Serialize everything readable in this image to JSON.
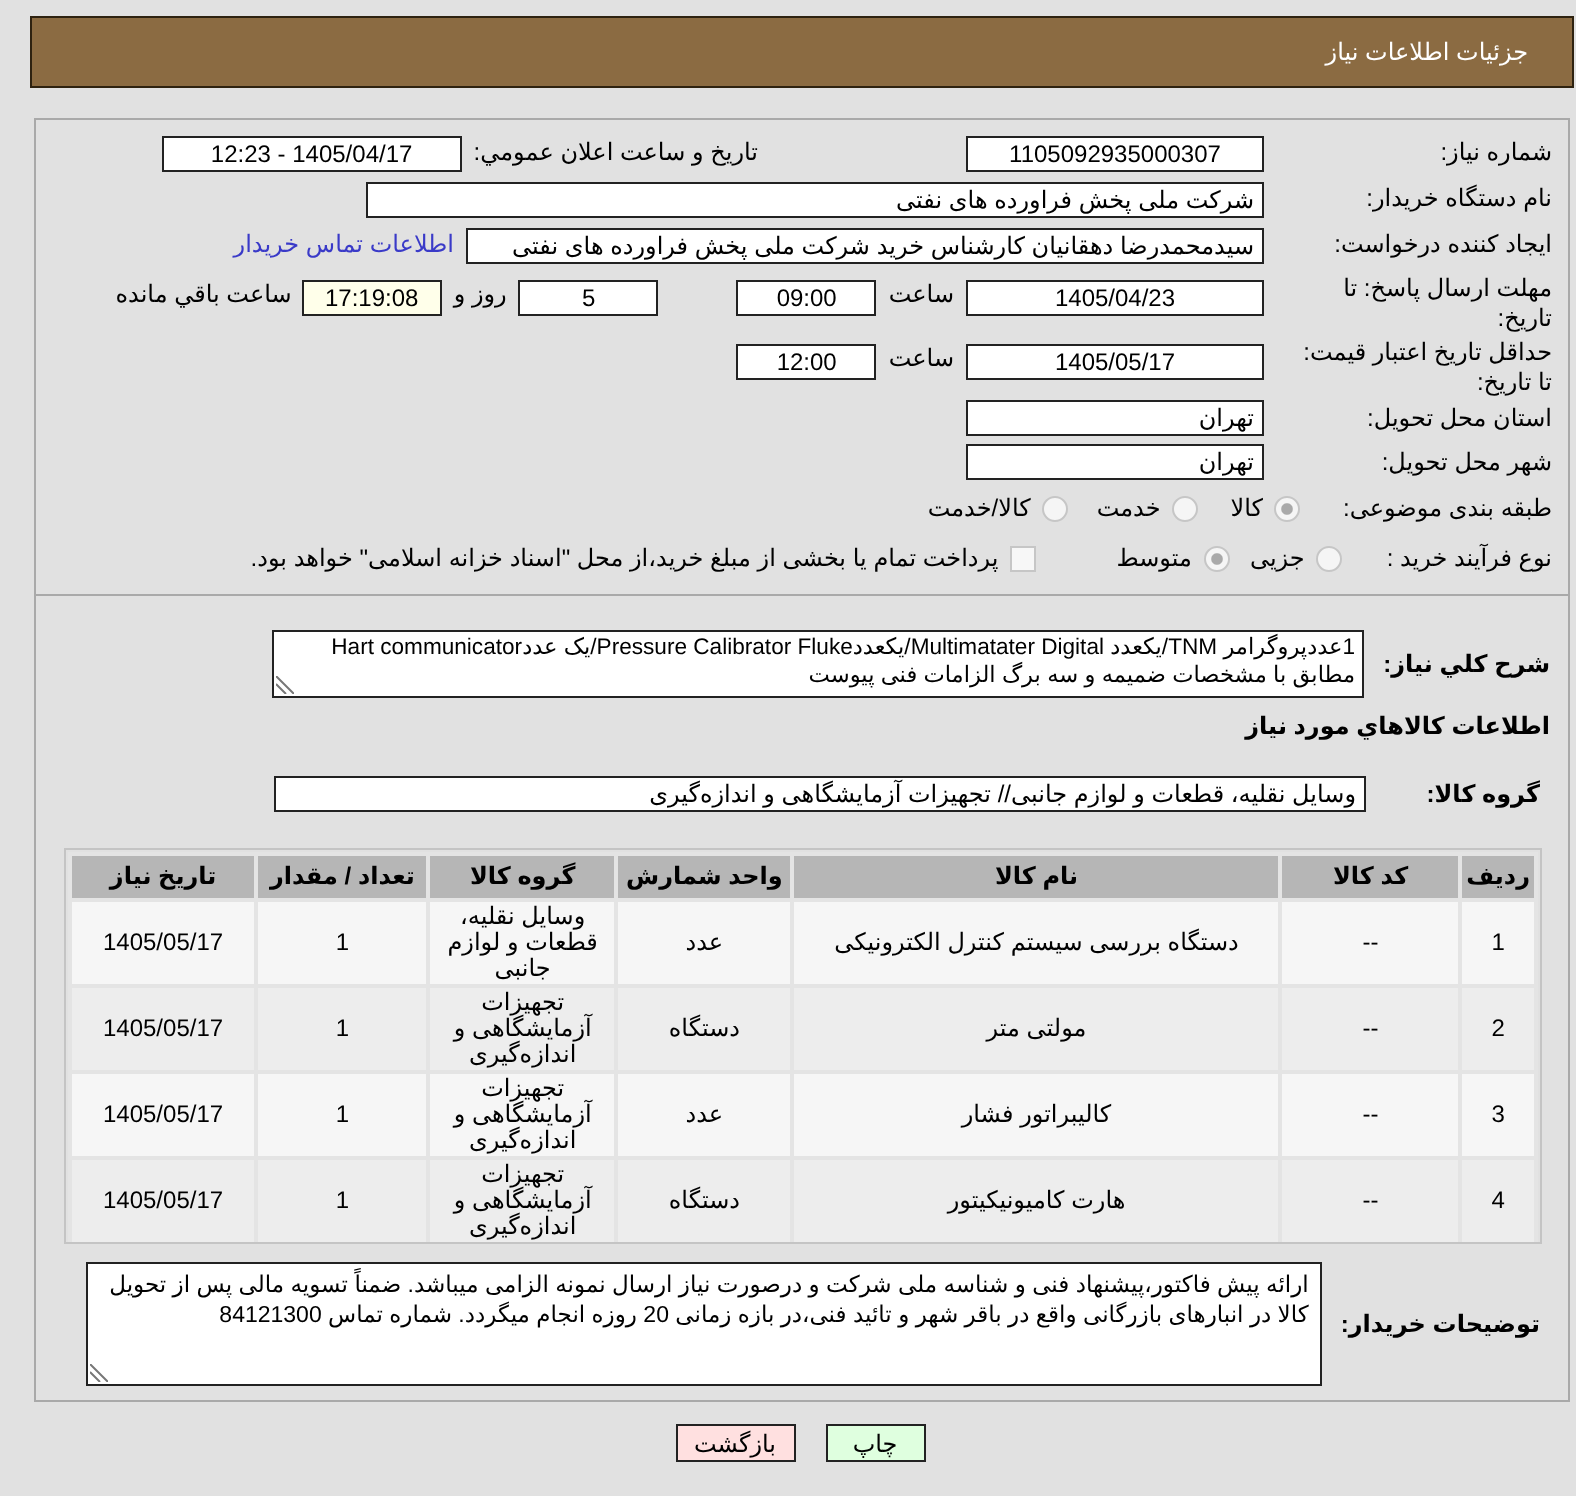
{
  "header": {
    "title": "جزئیات اطلاعات نیاز"
  },
  "need_number": {
    "label": "شماره نیاز:",
    "value": "1105092935000307"
  },
  "announcement": {
    "label": "تاریخ و ساعت اعلان عمومي:",
    "value": "1405/04/17 - 12:23"
  },
  "buyer_org": {
    "label": "نام دستگاه خریدار:",
    "value": "شرکت ملی پخش فراورده های نفتی"
  },
  "requester": {
    "label": "ایجاد کننده درخواست:",
    "value": "سیدمحمدرضا دهقانیان کارشناس خرید شرکت ملی پخش فراورده های نفتی",
    "contact_link": "اطلاعات تماس خریدار"
  },
  "response_deadline": {
    "label": "مهلت ارسال پاسخ: تا تاریخ:",
    "date": "1405/04/23",
    "time_label": "ساعت",
    "time": "09:00",
    "days": "5",
    "days_label": "روز و",
    "remaining": "17:19:08",
    "remaining_label": "ساعت باقي مانده"
  },
  "price_validity": {
    "label": "حداقل تاریخ اعتبار قیمت: تا تاریخ:",
    "date": "1405/05/17",
    "time_label": "ساعت",
    "time": "12:00"
  },
  "delivery_province": {
    "label": "استان محل تحویل:",
    "value": "تهران"
  },
  "delivery_city": {
    "label": "شهر محل تحویل:",
    "value": "تهران"
  },
  "category": {
    "label": "طبقه بندی موضوعی:",
    "options": [
      {
        "label": "کالا",
        "selected": true
      },
      {
        "label": "خدمت",
        "selected": false
      },
      {
        "label": "کالا/خدمت",
        "selected": false
      }
    ]
  },
  "purchase_type": {
    "label": "نوع فرآیند خرید :",
    "options": [
      {
        "label": "جزیی",
        "selected": false
      },
      {
        "label": "متوسط",
        "selected": true
      }
    ],
    "treasury_payment": {
      "label": "پرداخت تمام یا بخشی از مبلغ خرید،از محل \"اسناد خزانه اسلامی\" خواهد بود.",
      "checked": false
    }
  },
  "description": {
    "label": "شرح کلي نیاز:",
    "value": "1عددپروگرامر TNM/یکعدد Multimatater Digital/یکعددPressure Calibrator Fluke/یک عددHart communicator مطابق با مشخصات ضمیمه و سه برگ الزامات فنی پیوست"
  },
  "goods_heading": "اطلاعات کالاهاي مورد نیاز",
  "goods_group": {
    "label": "گروه کالا:",
    "value": "وسایل نقلیه، قطعات و لوازم جانبی// تجهیزات آزمایشگاهی و اندازه‌گیری"
  },
  "table": {
    "columns": [
      "ردیف",
      "کد کالا",
      "نام کالا",
      "واحد شمارش",
      "گروه کالا",
      "تعداد / مقدار",
      "تاریخ نیاز"
    ],
    "rows": [
      [
        "1",
        "--",
        "دستگاه بررسی سیستم کنترل الکترونیکی",
        "عدد",
        "وسایل نقلیه، قطعات و لوازم جانبی",
        "1",
        "1405/05/17"
      ],
      [
        "2",
        "--",
        "مولتی متر",
        "دستگاه",
        "تجهیزات آزمایشگاهی و اندازه‌گیری",
        "1",
        "1405/05/17"
      ],
      [
        "3",
        "--",
        "کالیبراتور فشار",
        "عدد",
        "تجهیزات آزمایشگاهی و اندازه‌گیری",
        "1",
        "1405/05/17"
      ],
      [
        "4",
        "--",
        "هارت کامیونیکیتور",
        "دستگاه",
        "تجهیزات آزمایشگاهی و اندازه‌گیری",
        "1",
        "1405/05/17"
      ]
    ]
  },
  "buyer_notes": {
    "label": "توضیحات خریدار:",
    "value": "ارائه پیش فاکتور،پیشنهاد فنی و شناسه ملی شرکت و درصورت نیاز ارسال نمونه الزامی میباشد. ضمناً تسویه مالی پس از تحویل کالا در انبارهای بازرگانی واقع در باقر شهر و تائید فنی،در بازه زمانی 20 روزه انجام میگردد. شماره تماس 84121300"
  },
  "buttons": [
    {
      "label": "چاپ",
      "kind": "print"
    },
    {
      "label": "بازگشت",
      "kind": "back"
    }
  ]
}
